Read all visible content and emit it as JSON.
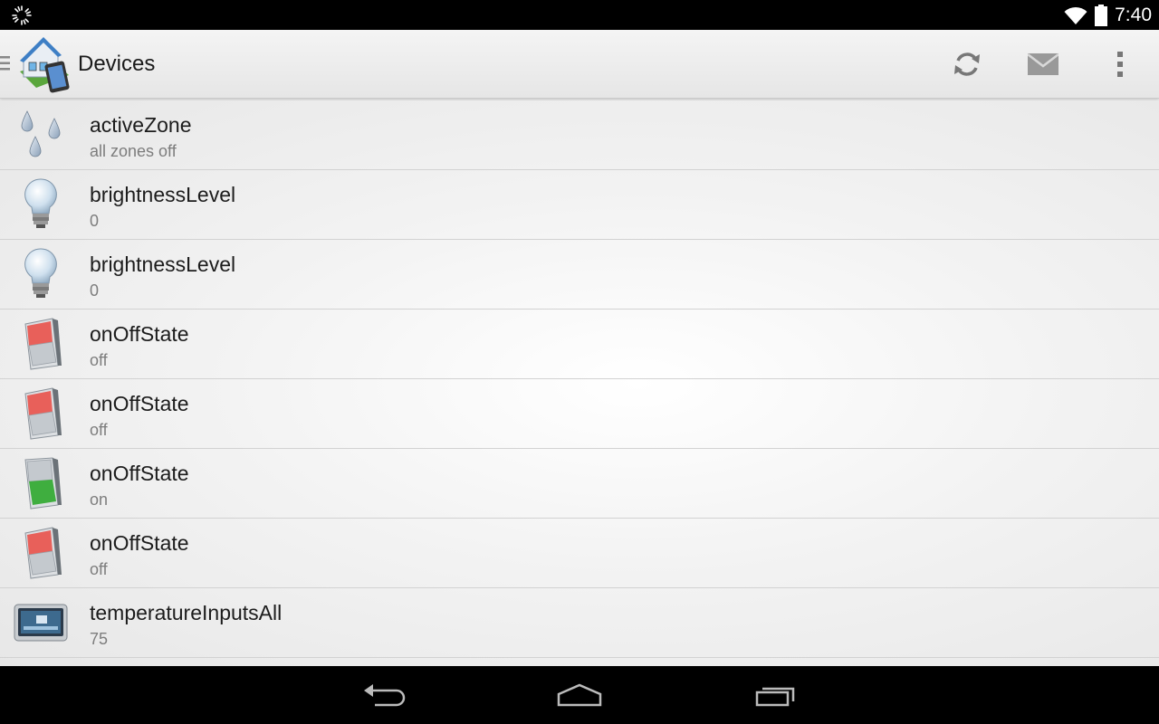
{
  "status_bar": {
    "time": "7:40",
    "left_icon": "loading-spinner-icon",
    "right_icons": [
      "wifi-icon",
      "battery-icon"
    ]
  },
  "action_bar": {
    "title": "Devices",
    "app_icon": "house-tablet-icon",
    "actions": [
      {
        "name": "refresh",
        "icon": "refresh-icon"
      },
      {
        "name": "mail",
        "icon": "mail-icon"
      },
      {
        "name": "overflow",
        "icon": "overflow-menu-icon"
      }
    ]
  },
  "devices": [
    {
      "title": "activeZone",
      "subtitle": "all zones off",
      "icon": "water-drops-icon"
    },
    {
      "title": "brightnessLevel",
      "subtitle": "0",
      "icon": "light-bulb-icon"
    },
    {
      "title": "brightnessLevel",
      "subtitle": "0",
      "icon": "light-bulb-icon"
    },
    {
      "title": "onOffState",
      "subtitle": "off",
      "icon": "switch-off-icon"
    },
    {
      "title": "onOffState",
      "subtitle": "off",
      "icon": "switch-off-icon"
    },
    {
      "title": "onOffState",
      "subtitle": "on",
      "icon": "switch-on-icon"
    },
    {
      "title": "onOffState",
      "subtitle": "off",
      "icon": "switch-off-icon"
    },
    {
      "title": "temperatureInputsAll",
      "subtitle": "75",
      "icon": "thermostat-icon"
    }
  ],
  "nav_bar": {
    "buttons": [
      "back-icon",
      "home-icon",
      "recents-icon"
    ]
  },
  "colors": {
    "switch_off": "#e8605a",
    "switch_on": "#3fae3f",
    "status_bar_bg": "#000000",
    "action_bar_bg": "#eeeeee"
  }
}
